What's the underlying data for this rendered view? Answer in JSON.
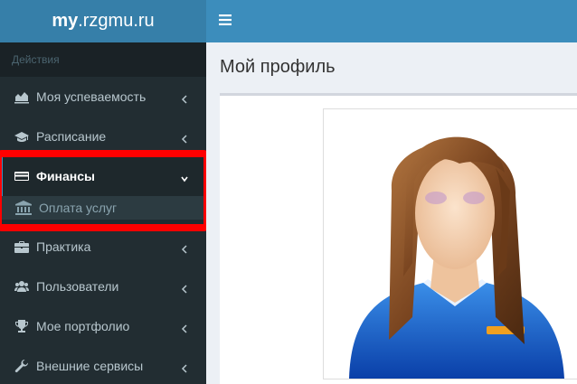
{
  "logo": {
    "bold": "my",
    "rest": ".rzgmu.ru"
  },
  "sidebar": {
    "section_header": "Действия",
    "items": [
      {
        "label": "Моя успеваемость",
        "icon": "area-chart-icon"
      },
      {
        "label": "Расписание",
        "icon": "graduation-cap-icon"
      },
      {
        "label": "Финансы",
        "icon": "credit-card-icon",
        "expanded": true
      },
      {
        "label": "Практика",
        "icon": "briefcase-icon"
      },
      {
        "label": "Пользователи",
        "icon": "users-icon"
      },
      {
        "label": "Мое портфолио",
        "icon": "trophy-icon"
      },
      {
        "label": "Внешние сервисы",
        "icon": "wrench-icon"
      }
    ],
    "sub_items": [
      {
        "label": "Оплата услуг",
        "icon": "bank-icon"
      }
    ]
  },
  "topbar": {
    "menu_icon": "hamburger-icon"
  },
  "main": {
    "title": "Мой профиль"
  },
  "colors": {
    "sidebar_bg": "#222d32",
    "header_bg": "#3c8dbc",
    "logo_bg": "#367fa9",
    "highlight": "#ff0000"
  }
}
